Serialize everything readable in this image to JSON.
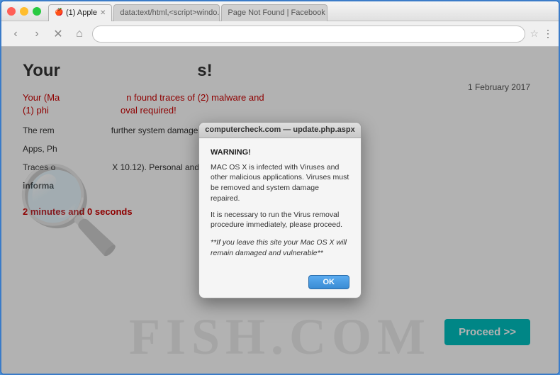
{
  "browser": {
    "tabs": [
      {
        "id": "tab1",
        "label": "(1) Apple",
        "active": true,
        "favicon": "🍎"
      },
      {
        "id": "tab2",
        "label": "data:text/html,<script>windo...",
        "active": false,
        "favicon": ""
      },
      {
        "id": "tab3",
        "label": "Page Not Found | Facebook",
        "active": false,
        "favicon": "f"
      }
    ],
    "address": "",
    "controls": {
      "back": "‹",
      "forward": "›",
      "reload": "×",
      "home": "⌂"
    }
  },
  "page": {
    "title": "Your ",
    "title_suffix": "s!",
    "subtitle": "Your (Ma",
    "subtitle2": "(1) phi",
    "subtitle_text": "n found traces of (2) malware and",
    "subtitle_text2": "oval required!",
    "date": "1 February 2017",
    "body1": "The rem",
    "body1_suffix": "further system damage, loss of",
    "body2": "Apps, Ph",
    "body3": "Traces o",
    "body3_suffix": "X 10.12). Personal and banking",
    "body4": "informa",
    "timer": "2 minutes and 0 seconds",
    "proceed_label": "Proceed >>"
  },
  "alert": {
    "titlebar_text": "computercheck.com — update.php.aspx",
    "warning_label": "WARNING!",
    "message1": "MAC OS X is infected with Viruses and other malicious applications. Viruses must be removed and system damage repaired.",
    "message2": "It is necessary to run the Virus removal procedure immediately, please proceed.",
    "message3": "**If you leave this site your Mac OS X will remain damaged and vulnerable**",
    "ok_label": "OK"
  },
  "watermark": {
    "text": "FISH.COM",
    "icon": "🔍"
  }
}
